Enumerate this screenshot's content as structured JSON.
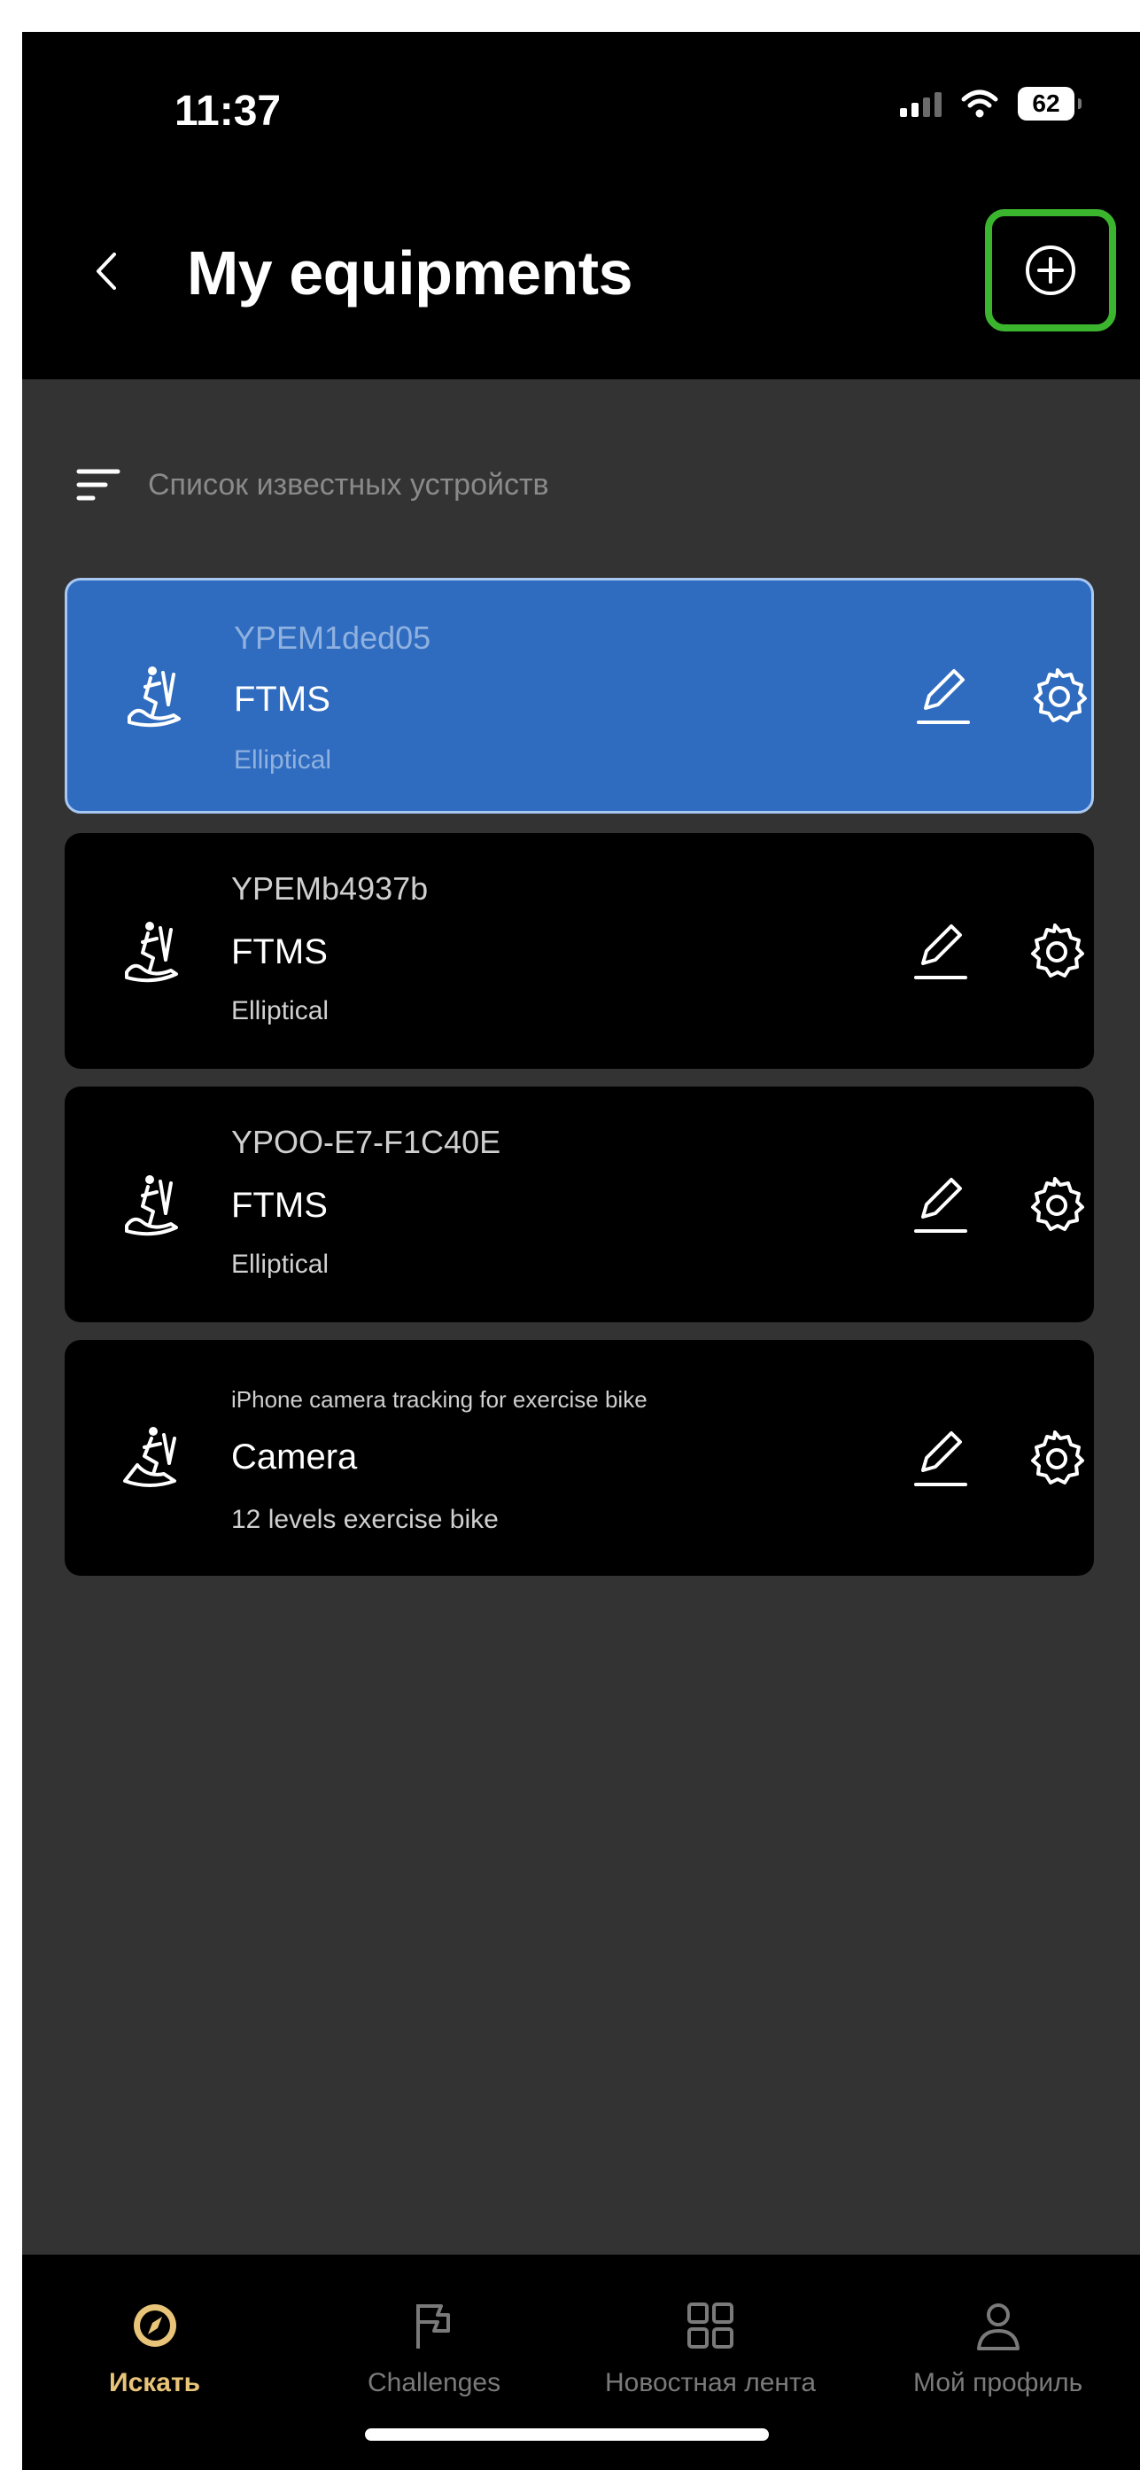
{
  "status": {
    "time": "11:37",
    "battery": "62"
  },
  "header": {
    "title": "My equipments"
  },
  "filter": {
    "label": "Список известных устройств"
  },
  "devices": [
    {
      "id": "YPEM1ded05",
      "protocol": "FTMS",
      "type": "Elliptical",
      "selected": true,
      "icon": "elliptical-icon"
    },
    {
      "id": "YPEMb4937b",
      "protocol": "FTMS",
      "type": "Elliptical",
      "selected": false,
      "icon": "elliptical-icon"
    },
    {
      "id": "YPOO-E7-F1C40E",
      "protocol": "FTMS",
      "type": "Elliptical",
      "selected": false,
      "icon": "elliptical-icon"
    },
    {
      "id": "iPhone camera tracking for exercise bike",
      "protocol": "Camera",
      "type": "12 levels exercise bike",
      "selected": false,
      "icon": "exercise-bike-icon"
    }
  ],
  "tabs": [
    {
      "label": "Искать",
      "icon": "compass-icon",
      "active": true
    },
    {
      "label": "Challenges",
      "icon": "flag-icon",
      "active": false
    },
    {
      "label": "Новостная лента",
      "icon": "grid-icon",
      "active": false
    },
    {
      "label": "Мой профиль",
      "icon": "person-icon",
      "active": false
    }
  ],
  "colors": {
    "accent_selected": "#2f6cc0",
    "highlight": "#3cb52e",
    "active_tab": "#e8c479"
  }
}
